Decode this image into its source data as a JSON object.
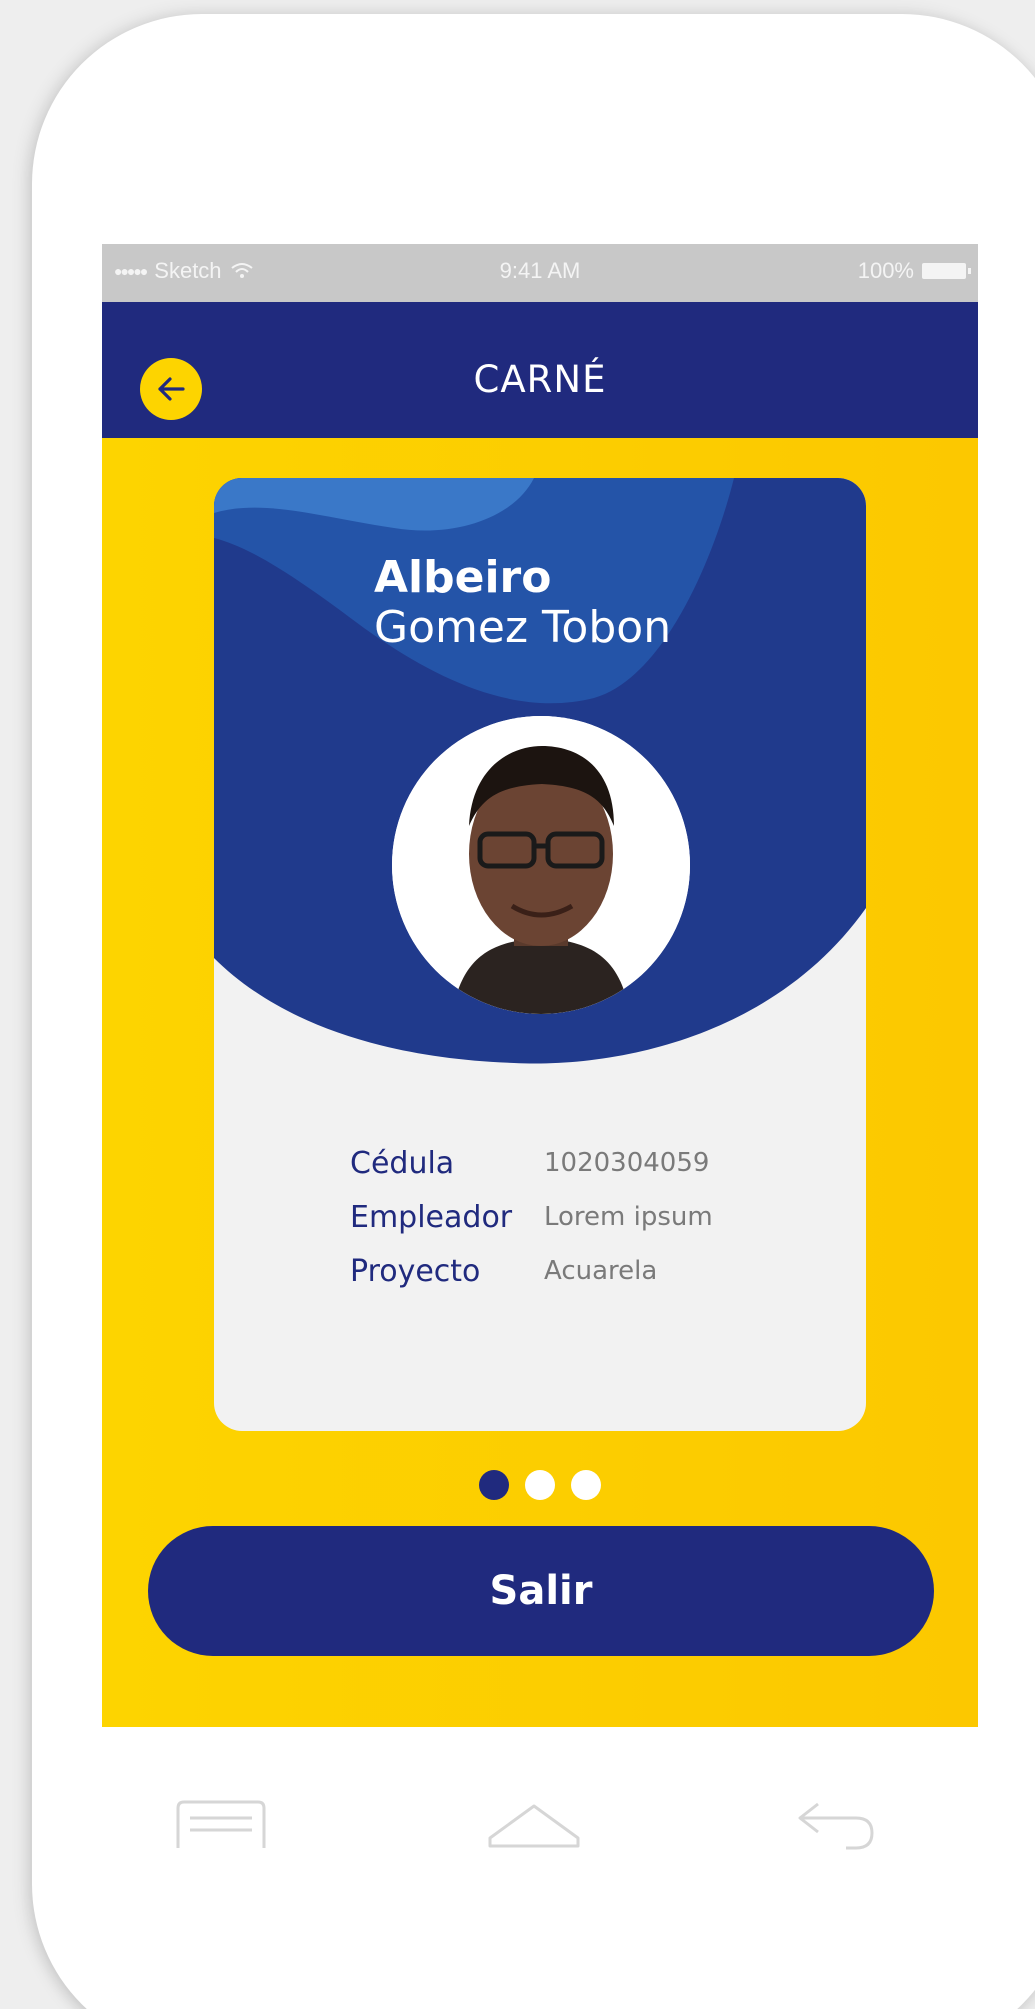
{
  "status_bar": {
    "carrier": "Sketch",
    "time": "9:41 AM",
    "battery": "100%"
  },
  "header": {
    "title": "CARNÉ",
    "back_icon": "arrow-left-icon"
  },
  "card": {
    "first_name": "Albeiro",
    "last_name": "Gomez Tobon",
    "fields": [
      {
        "label": "Cédula",
        "value": "1020304059"
      },
      {
        "label": "Empleador",
        "value": "Lorem ipsum"
      },
      {
        "label": "Proyecto",
        "value": "Acuarela"
      }
    ]
  },
  "pager": {
    "count": 3,
    "active": 0
  },
  "exit_button": {
    "label": "Salir"
  },
  "nav_bar": {
    "items": [
      "menu-icon",
      "home-icon",
      "back-icon"
    ]
  },
  "colors": {
    "primary": "#202a7e",
    "accent": "#fdd400",
    "card_bg": "#f2f2f2"
  }
}
